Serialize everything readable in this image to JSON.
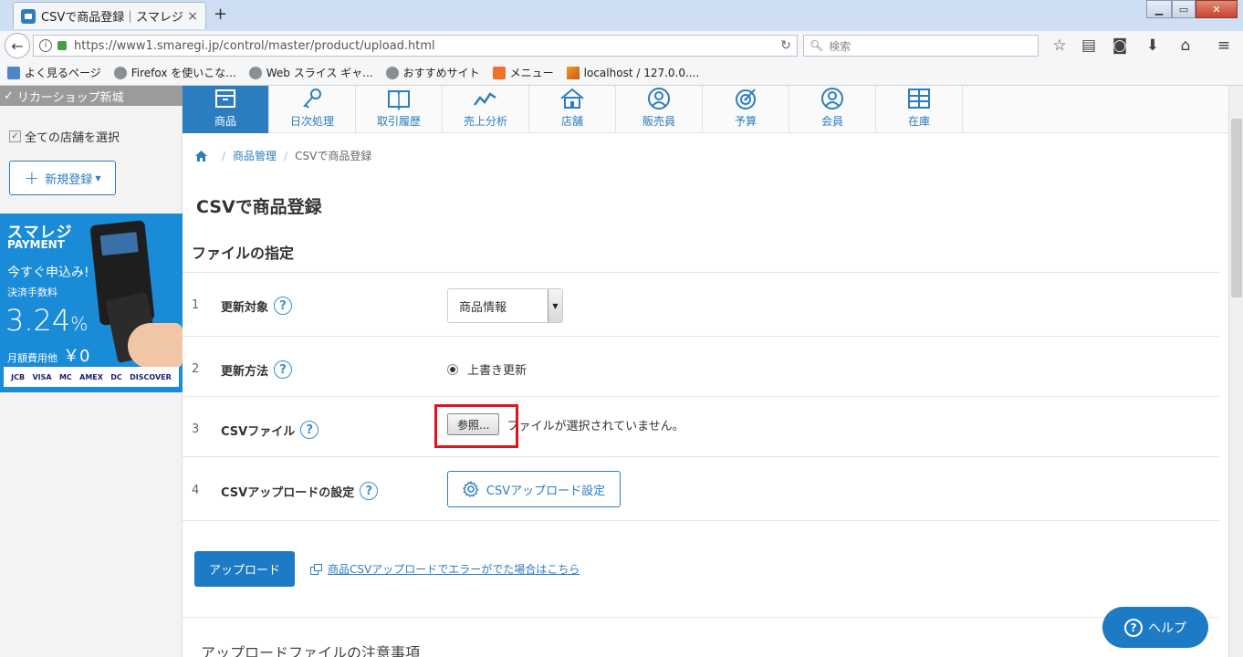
{
  "browser": {
    "tab_title": "CSVで商品登録｜スマレジ",
    "tab_close": "×",
    "newtab": "+",
    "url": "https://www1.smaregi.jp/control/master/product/upload.html",
    "search_placeholder": "検索",
    "bookmarks": [
      {
        "label": "よく見るページ",
        "icon": "bookmark-page-icon"
      },
      {
        "label": "Firefox を使いこな...",
        "icon": "globe-icon"
      },
      {
        "label": "Web スライス ギャ...",
        "icon": "globe-icon"
      },
      {
        "label": "おすすめサイト",
        "icon": "globe-icon"
      },
      {
        "label": "メニュー",
        "icon": "xampp-icon"
      },
      {
        "label": "localhost / 127.0.0....",
        "icon": "phpmyadmin-icon"
      }
    ]
  },
  "sidebar": {
    "shop_name": "リカーショップ新城",
    "select_all": "全ての店舗を選択",
    "new_registration": "新規登録",
    "banner": {
      "title": "スマレジ",
      "subtitle": "PAYMENT",
      "apply": "今すぐ申込み!",
      "fee_label": "決済手数料",
      "rate": "3.24",
      "rate_unit": "%",
      "monthly": "月額費用他",
      "monthly_value": "￥0",
      "cards": [
        "JCB",
        "VISA",
        "MC",
        "AMEX",
        "DC",
        "DISCOVER"
      ]
    }
  },
  "modules": [
    {
      "label": "商品",
      "icon": "box-icon",
      "active": true
    },
    {
      "label": "日次処理",
      "icon": "key-icon",
      "active": false
    },
    {
      "label": "取引履歴",
      "icon": "book-icon",
      "active": false
    },
    {
      "label": "売上分析",
      "icon": "trend-chart-icon",
      "active": false
    },
    {
      "label": "店舗",
      "icon": "house-icon",
      "active": false
    },
    {
      "label": "販売員",
      "icon": "person-icon",
      "active": false
    },
    {
      "label": "予算",
      "icon": "target-icon",
      "active": false
    },
    {
      "label": "会員",
      "icon": "member-icon",
      "active": false
    },
    {
      "label": "在庫",
      "icon": "grid-icon",
      "active": false
    }
  ],
  "breadcrumb": {
    "items": [
      "商品管理",
      "CSVで商品登録"
    ]
  },
  "page": {
    "title": "CSVで商品登録",
    "section_title": "ファイルの指定",
    "rows": [
      {
        "num": "1",
        "label": "更新対象"
      },
      {
        "num": "2",
        "label": "更新方法"
      },
      {
        "num": "3",
        "label": "CSVファイル"
      },
      {
        "num": "4",
        "label": "CSVアップロードの設定"
      }
    ],
    "update_target_value": "商品情報",
    "update_method_value": "上書き更新",
    "file_button": "参照...",
    "file_status": "ファイルが選択されていません。",
    "csv_settings_button": "CSVアップロード設定",
    "upload_button": "アップロード",
    "error_link": "商品CSVアップロードでエラーがでた場合はこちら",
    "notes_title": "アップロードファイルの注意事項"
  },
  "help": {
    "label": "ヘルプ",
    "glyph": "?"
  },
  "colors": {
    "accent": "#2b7dc0",
    "highlight": "#e0141e"
  }
}
